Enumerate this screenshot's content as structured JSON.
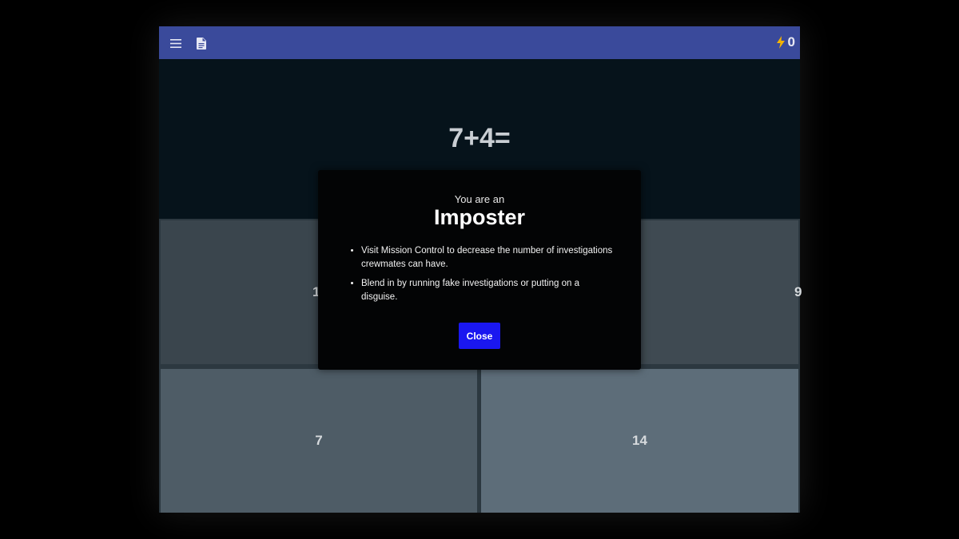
{
  "topbar": {
    "menu_icon": "hamburger-menu-icon",
    "doc_icon": "document-icon",
    "energy_icon": "lightning-bolt-icon",
    "energy_count": "0"
  },
  "question": {
    "text": "7+4="
  },
  "answers": [
    {
      "label": "1"
    },
    {
      "label": "9"
    },
    {
      "label": "7"
    },
    {
      "label": "14"
    }
  ],
  "modal": {
    "subtitle": "You are an",
    "title": "Imposter",
    "bullets": [
      "Visit Mission Control to decrease the number of investigations crewmates can have.",
      "Blend in by running fake investigations or putting on a disguise."
    ],
    "close_label": "Close"
  },
  "colors": {
    "topbar": "#3a4a9b",
    "close_button": "#1a17f0",
    "bolt": "#f5b400"
  }
}
